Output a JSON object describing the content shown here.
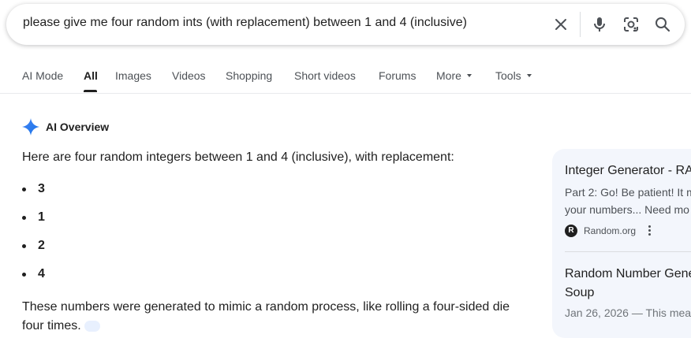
{
  "search": {
    "query": "please give me four random ints (with replacement) between 1 and 4 (inclusive)",
    "icons": [
      "close-icon",
      "mic-icon",
      "lens-icon",
      "search-icon"
    ]
  },
  "tabs": [
    {
      "label": "AI Mode",
      "active": false
    },
    {
      "label": "All",
      "active": true
    },
    {
      "label": "Images",
      "active": false
    },
    {
      "label": "Videos",
      "active": false
    },
    {
      "label": "Shopping",
      "active": false
    },
    {
      "label": "Short videos",
      "active": false
    },
    {
      "label": "Forums",
      "active": false
    },
    {
      "label": "More",
      "active": false,
      "dropdown": true
    },
    {
      "label": "Tools",
      "active": false,
      "dropdown": true
    }
  ],
  "ai_overview": {
    "title": "AI Overview",
    "intro": "Here are four random integers between 1 and 4 (inclusive), with replacement:",
    "numbers": [
      "3",
      "1",
      "2",
      "4"
    ],
    "explanation": "These numbers were generated to mimic a random process, like rolling a four-sided die four times."
  },
  "sources": [
    {
      "title": "Integer Generator - RA",
      "snippet_lines": [
        "Part 2: Go! Be patient! It m",
        "your numbers... Need mo"
      ],
      "site": "Random.org",
      "favicon_letter": "R"
    },
    {
      "title_lines": [
        "Random Number Gene",
        "Soup"
      ],
      "date": "Jan 26, 2026 — This mear"
    }
  ],
  "colors": {
    "accent_blue": "#4285f4",
    "text_primary": "#1f1f1f",
    "text_secondary": "#4d5156",
    "source_panel_bg": "#f3f6fc"
  }
}
